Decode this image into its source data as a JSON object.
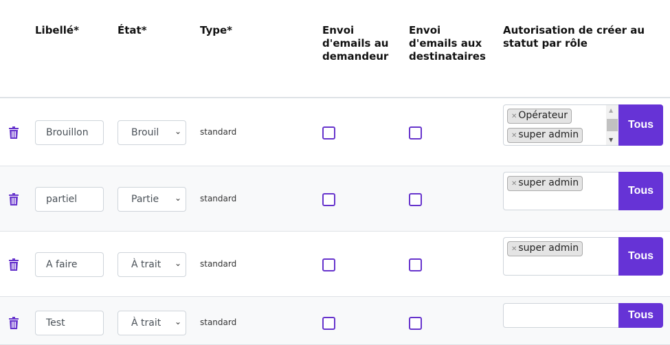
{
  "headers": {
    "libelle": "Libellé*",
    "etat": "État*",
    "type": "Type*",
    "envoi_demandeur": "Envoi d'emails au demandeur",
    "envoi_destinataires": "Envoi d'emails aux destinataires",
    "autorisation": "Autorisation de créer au statut par rôle"
  },
  "tous_label": "Tous",
  "rows": [
    {
      "libelle": "Brouillon",
      "etat": "Brouil",
      "type": "standard",
      "roles": [
        "Opérateur",
        "super admin"
      ]
    },
    {
      "libelle": "partiel",
      "etat": "Partie",
      "type": "standard",
      "roles": [
        "super admin"
      ]
    },
    {
      "libelle": "A faire",
      "etat": "À trait",
      "type": "standard",
      "roles": [
        "super admin"
      ]
    },
    {
      "libelle": "Test",
      "etat": "À trait",
      "type": "standard",
      "roles": []
    }
  ],
  "colors": {
    "accent": "#6633d6"
  }
}
